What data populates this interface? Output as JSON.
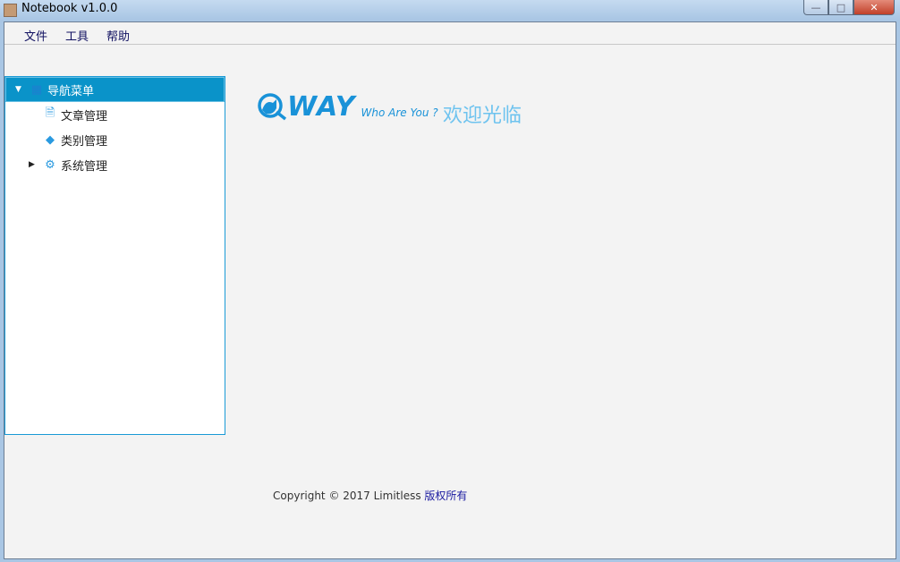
{
  "window": {
    "title": "Notebook v1.0.0",
    "min": "—",
    "max": "□",
    "close": "✕"
  },
  "menu": [
    "文件",
    "工具",
    "帮助"
  ],
  "tree": {
    "root": "导航菜单",
    "items": [
      "文章管理",
      "类别管理",
      "系统管理"
    ]
  },
  "logo": {
    "way": "WAY",
    "tagline": "Who Are You ?"
  },
  "welcome": "欢迎光临",
  "footer": {
    "copyright": "Copyright © 2017 Limitless",
    "rights": "版权所有"
  }
}
